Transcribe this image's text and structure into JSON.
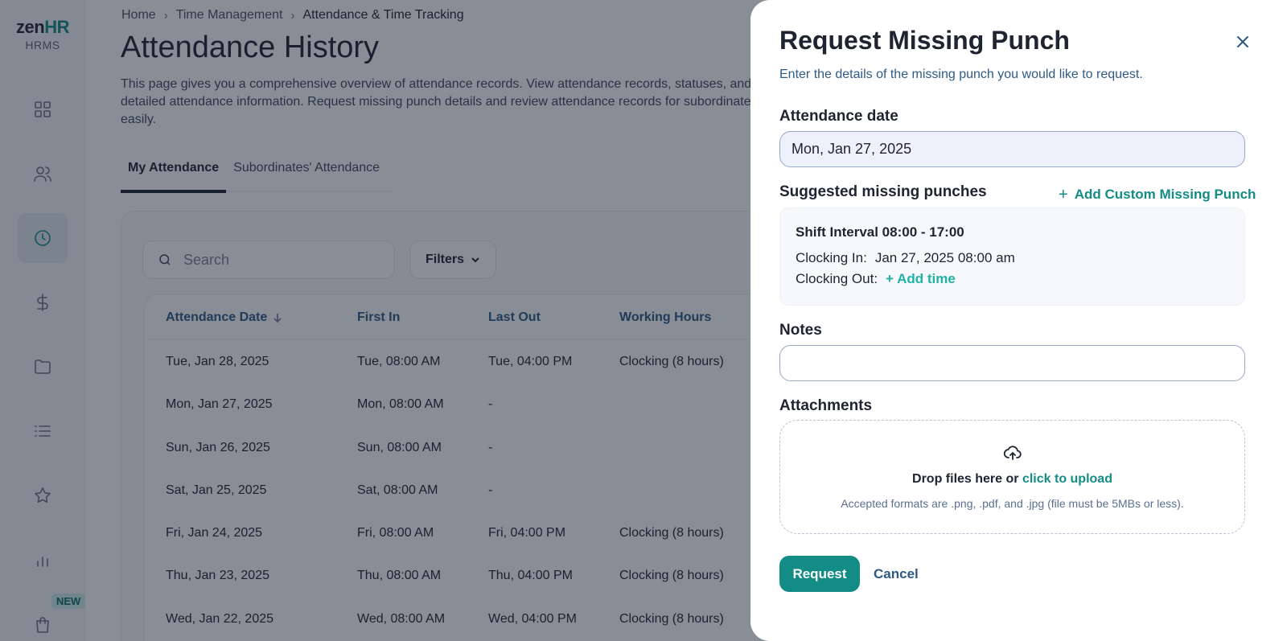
{
  "brand": {
    "logo_zen": "zen",
    "logo_hr": "HR",
    "product": "HRMS",
    "accent_color": "#138c86"
  },
  "sidebar": {
    "items": [
      {
        "icon": "dashboard-grid-icon"
      },
      {
        "icon": "users-icon"
      },
      {
        "icon": "clock-icon",
        "active": true
      },
      {
        "icon": "dollar-icon"
      },
      {
        "icon": "folder-icon"
      },
      {
        "icon": "list-icon"
      },
      {
        "icon": "star-icon"
      },
      {
        "icon": "bar-chart-icon"
      },
      {
        "icon": "shopping-bag-icon"
      }
    ],
    "new_badge": "NEW"
  },
  "breadcrumb": {
    "home": "Home",
    "section": "Time Management",
    "current": "Attendance & Time Tracking"
  },
  "page": {
    "title": "Attendance History",
    "description": "This page gives you a comprehensive overview of attendance records. View attendance records, statuses, and detailed attendance information. Request missing punch details and review attendance records for subordinates easily."
  },
  "tabs": [
    {
      "label": "My Attendance",
      "active": true
    },
    {
      "label": "Subordinates' Attendance",
      "active": false
    }
  ],
  "toolbar": {
    "search_placeholder": "Search",
    "filters_label": "Filters"
  },
  "table": {
    "headers": [
      "Attendance Date",
      "First In",
      "Last Out",
      "Working Hours"
    ],
    "rows": [
      [
        "Tue, Jan 28, 2025",
        "Tue, 08:00 AM",
        "Tue, 04:00 PM",
        "Clocking (8 hours)"
      ],
      [
        "Mon, Jan 27, 2025",
        "Mon, 08:00 AM",
        "-",
        ""
      ],
      [
        "Sun, Jan 26, 2025",
        "Sun, 08:00 AM",
        "-",
        ""
      ],
      [
        "Sat, Jan 25, 2025",
        "Sat, 08:00 AM",
        "-",
        ""
      ],
      [
        "Fri, Jan 24, 2025",
        "Fri, 08:00 AM",
        "Fri, 04:00 PM",
        "Clocking (8 hours)"
      ],
      [
        "Thu, Jan 23, 2025",
        "Thu, 08:00 AM",
        "Thu, 04:00 PM",
        "Clocking (8 hours)"
      ],
      [
        "Wed, Jan 22, 2025",
        "Wed, 08:00 AM",
        "Wed, 04:00 PM",
        "Clocking (8 hours)"
      ]
    ]
  },
  "drawer": {
    "title": "Request Missing Punch",
    "subtitle": "Enter the details of the missing punch you would like to request.",
    "date_label": "Attendance date",
    "date_value": "Mon, Jan 27, 2025",
    "suggested_label": "Suggested missing punches",
    "add_custom_label": "Add Custom Missing Punch",
    "shift_title": "Shift Interval 08:00 - 17:00",
    "clock_in_label": "Clocking In:",
    "clock_in_value": "Jan 27, 2025 08:00 am",
    "clock_out_label": "Clocking Out:",
    "add_time_label": "+ Add time",
    "notes_label": "Notes",
    "notes_value": "",
    "attachments_label": "Attachments",
    "dropzone_text": "Drop files here or",
    "dropzone_link": "click to upload",
    "dropzone_hint": "Accepted formats are .png, .pdf, and .jpg (file must be 5MBs or less).",
    "request_label": "Request",
    "cancel_label": "Cancel"
  }
}
